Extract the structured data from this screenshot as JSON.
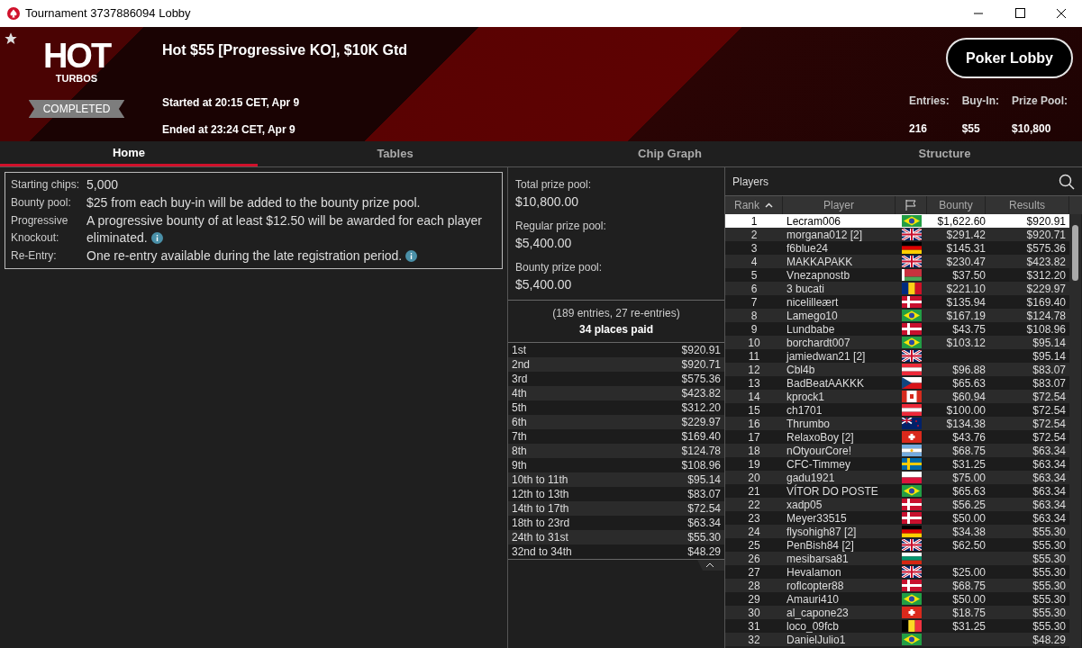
{
  "window": {
    "title": "Tournament 3737886094 Lobby"
  },
  "header": {
    "logo_top": "HOT",
    "logo_bottom": "TURBOS",
    "status": "COMPLETED",
    "favorite": true,
    "name": "Hot $55 [Progressive KO], $10K Gtd",
    "started": "Started at 20:15 CET, Apr 9",
    "ended": "Ended at 23:24 CET, Apr 9",
    "lobby_button": "Poker Lobby",
    "stats": [
      {
        "label": "Entries:",
        "value": "216"
      },
      {
        "label": "Buy-In:",
        "value": "$55"
      },
      {
        "label": "Prize Pool:",
        "value": "$10,800"
      }
    ]
  },
  "tabs": [
    {
      "label": "Home",
      "selected": true
    },
    {
      "label": "Tables",
      "selected": false
    },
    {
      "label": "Chip Graph",
      "selected": false
    },
    {
      "label": "Structure",
      "selected": false
    }
  ],
  "info": [
    {
      "label": "Starting chips:",
      "value": "5,000",
      "info": false
    },
    {
      "label": "Bounty pool:",
      "value": "$25 from each buy-in will be added to the bounty prize pool.",
      "info": false
    },
    {
      "label": "Progressive Knockout:",
      "value": "A progressive bounty of at least $12.50 will be awarded for each player eliminated.",
      "info": true
    },
    {
      "label": "Re-Entry:",
      "value": "One re-entry available during the late registration period.",
      "info": true
    }
  ],
  "prize_pools": [
    {
      "label": "Total prize pool:",
      "value": "$10,800.00"
    },
    {
      "label": "Regular prize pool:",
      "value": "$5,400.00"
    },
    {
      "label": "Bounty prize pool:",
      "value": "$5,400.00"
    }
  ],
  "entries_note": "(189 entries, 27 re-entries)",
  "places_paid": "34 places paid",
  "payouts": [
    {
      "place": "1st",
      "amount": "$920.91"
    },
    {
      "place": "2nd",
      "amount": "$920.71"
    },
    {
      "place": "3rd",
      "amount": "$575.36"
    },
    {
      "place": "4th",
      "amount": "$423.82"
    },
    {
      "place": "5th",
      "amount": "$312.20"
    },
    {
      "place": "6th",
      "amount": "$229.97"
    },
    {
      "place": "7th",
      "amount": "$169.40"
    },
    {
      "place": "8th",
      "amount": "$124.78"
    },
    {
      "place": "9th",
      "amount": "$108.96"
    },
    {
      "place": "10th to 11th",
      "amount": "$95.14"
    },
    {
      "place": "12th to 13th",
      "amount": "$83.07"
    },
    {
      "place": "14th to 17th",
      "amount": "$72.54"
    },
    {
      "place": "18th to 23rd",
      "amount": "$63.34"
    },
    {
      "place": "24th to 31st",
      "amount": "$55.30"
    },
    {
      "place": "32nd to 34th",
      "amount": "$48.29"
    }
  ],
  "players": {
    "title": "Players",
    "columns": [
      {
        "kind": "text",
        "label": "Rank",
        "sorted": true
      },
      {
        "kind": "text",
        "label": "Player",
        "sorted": false
      },
      {
        "kind": "flag",
        "sorted": false
      },
      {
        "kind": "text",
        "label": "Bounty",
        "sorted": false
      },
      {
        "kind": "text",
        "label": "Results",
        "sorted": false
      }
    ],
    "rows": [
      {
        "rank": "1",
        "player": "Lecram006",
        "kind": "br",
        "bounty": "$1,622.60",
        "results": "$920.91",
        "selected": true
      },
      {
        "rank": "2",
        "player": "morgana012 [2]",
        "kind": "gb",
        "bounty": "$291.42",
        "results": "$920.71",
        "selected": false
      },
      {
        "rank": "3",
        "player": "f6blue24",
        "kind": "de",
        "bounty": "$145.31",
        "results": "$575.36",
        "selected": false
      },
      {
        "rank": "4",
        "player": "MAKKAPAKK",
        "kind": "gb",
        "bounty": "$230.47",
        "results": "$423.82",
        "selected": false
      },
      {
        "rank": "5",
        "player": "Vnezapnostb",
        "kind": "by",
        "bounty": "$37.50",
        "results": "$312.20",
        "selected": false
      },
      {
        "rank": "6",
        "player": "3 bucati",
        "kind": "ro",
        "bounty": "$221.10",
        "results": "$229.97",
        "selected": false
      },
      {
        "rank": "7",
        "player": "nicelilleært",
        "kind": "dk",
        "bounty": "$135.94",
        "results": "$169.40",
        "selected": false
      },
      {
        "rank": "8",
        "player": "Lamego10",
        "kind": "br",
        "bounty": "$167.19",
        "results": "$124.78",
        "selected": false
      },
      {
        "rank": "9",
        "player": "Lundbabe",
        "kind": "dk",
        "bounty": "$43.75",
        "results": "$108.96",
        "selected": false
      },
      {
        "rank": "10",
        "player": "borchardt007",
        "kind": "br",
        "bounty": "$103.12",
        "results": "$95.14",
        "selected": false
      },
      {
        "rank": "11",
        "player": "jamiedwan21 [2]",
        "kind": "gb",
        "results": "$95.14",
        "selected": false
      },
      {
        "rank": "12",
        "player": "Cbl4b",
        "kind": "at",
        "bounty": "$96.88",
        "results": "$83.07",
        "selected": false
      },
      {
        "rank": "13",
        "player": "BadBeatAAKKK",
        "kind": "cz",
        "bounty": "$65.63",
        "results": "$83.07",
        "selected": false
      },
      {
        "rank": "14",
        "player": "kprock1",
        "kind": "ca",
        "bounty": "$60.94",
        "results": "$72.54",
        "selected": false
      },
      {
        "rank": "15",
        "player": "ch1701",
        "kind": "at",
        "bounty": "$100.00",
        "results": "$72.54",
        "selected": false
      },
      {
        "rank": "16",
        "player": "Thrumbo",
        "kind": "nz",
        "bounty": "$134.38",
        "results": "$72.54",
        "selected": false
      },
      {
        "rank": "17",
        "player": "RelaxoBoy [2]",
        "kind": "ch",
        "bounty": "$43.76",
        "results": "$72.54",
        "selected": false
      },
      {
        "rank": "18",
        "player": "nOtyourCore!",
        "kind": "ar",
        "bounty": "$68.75",
        "results": "$63.34",
        "selected": false
      },
      {
        "rank": "19",
        "player": "CFC-Timmey",
        "kind": "se",
        "bounty": "$31.25",
        "results": "$63.34",
        "selected": false
      },
      {
        "rank": "20",
        "player": "gadu1921",
        "kind": "pl",
        "bounty": "$75.00",
        "results": "$63.34",
        "selected": false
      },
      {
        "rank": "21",
        "player": "VÍTOR DO POSTE",
        "kind": "br",
        "bounty": "$65.63",
        "results": "$63.34",
        "selected": false
      },
      {
        "rank": "22",
        "player": "xadp05",
        "kind": "dk",
        "bounty": "$56.25",
        "results": "$63.34",
        "selected": false
      },
      {
        "rank": "23",
        "player": "Meyer33515",
        "kind": "dk",
        "bounty": "$50.00",
        "results": "$63.34",
        "selected": false
      },
      {
        "rank": "24",
        "player": "flysohigh87 [2]",
        "kind": "de",
        "bounty": "$34.38",
        "results": "$55.30",
        "selected": false
      },
      {
        "rank": "25",
        "player": "PenBish84 [2]",
        "kind": "gb",
        "bounty": "$62.50",
        "results": "$55.30",
        "selected": false
      },
      {
        "rank": "26",
        "player": "mesibarsa81",
        "kind": "bg",
        "results": "$55.30",
        "selected": false
      },
      {
        "rank": "27",
        "player": "Hevalamon",
        "kind": "gb",
        "bounty": "$25.00",
        "results": "$55.30",
        "selected": false
      },
      {
        "rank": "28",
        "player": "roflcopter88",
        "kind": "dk",
        "bounty": "$68.75",
        "results": "$55.30",
        "selected": false
      },
      {
        "rank": "29",
        "player": "Amauri410",
        "kind": "br",
        "bounty": "$50.00",
        "results": "$55.30",
        "selected": false
      },
      {
        "rank": "30",
        "player": "al_capone23",
        "kind": "ch",
        "bounty": "$18.75",
        "results": "$55.30",
        "selected": false
      },
      {
        "rank": "31",
        "player": "loco_09fcb",
        "kind": "be",
        "bounty": "$31.25",
        "results": "$55.30",
        "selected": false
      },
      {
        "rank": "32",
        "player": "DanielJulio1",
        "kind": "br",
        "results": "$48.29",
        "selected": false
      }
    ]
  }
}
